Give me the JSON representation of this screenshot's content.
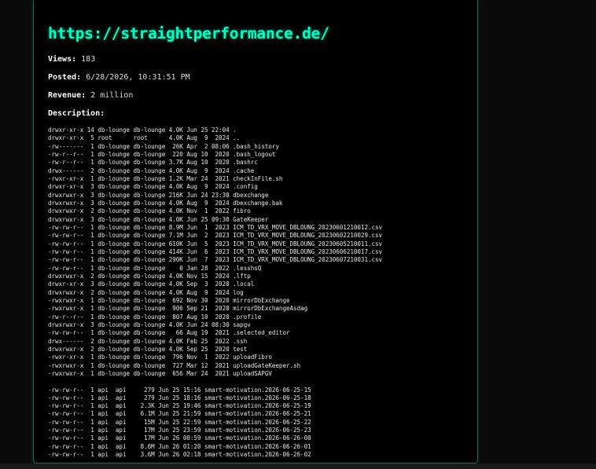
{
  "site": {
    "url": "https://straightperformance.de/"
  },
  "meta": {
    "views_label": "Views:",
    "views_value": "183",
    "posted_label": "Posted:",
    "posted_value": "6/28/2026, 10:31:51 PM",
    "revenue_label": "Revenue:",
    "revenue_value": "2 million",
    "description_label": "Description:"
  },
  "listing": {
    "block1": [
      "drwxr-xr-x 14 db-lounge db-lounge 4.0K Jun 25 22:04 .",
      "drwxr-xr-x  5 root      root      4.0K Aug  9  2024 ..",
      "-rw-------  1 db-lounge db-lounge  26K Apr  2 08:06 .bash_history",
      "-rw-r--r--  1 db-lounge db-lounge  220 Aug 10  2020 .bash_logout",
      "-rw-r--r--  1 db-lounge db-lounge 3.7K Aug 10  2020 .bashrc",
      "drwx------  2 db-lounge db-lounge 4.0K Aug  9  2024 .cache",
      "-rwxr-xr-x  1 db-lounge db-lounge 1.2K Mar 24  2021 checkInFile.sh",
      "drwxr-xr-x  3 db-lounge db-lounge 4.0K Aug  9  2024 .config",
      "drwxrwxr-x  3 db-lounge db-lounge 216K Jun 24 23:30 dbexchange",
      "drwxrwxr-x  3 db-lounge db-lounge 4.0K Aug  9  2024 dbexchange.bak",
      "drwxrwxr-x  2 db-lounge db-lounge 4.0K Nov  1  2022 fibro",
      "drwxrwxr-x  3 db-lounge db-lounge 4.0K Jun 25 09:30 GateKeeper",
      "-rw-rw-r--  1 db-lounge db-lounge 8.9M Jun  1  2023 ICM_TD_VRX_MOVE_DBLOUNG_20230601210012.csv",
      "-rw-rw-r--  1 db-lounge db-lounge 7.1M Jun  2  2023 ICM_TD_VRX_MOVE_DBLOUNG_20230602210029.csv",
      "-rw-rw-r--  1 db-lounge db-lounge 610K Jun  5  2023 ICM_TD_VRX_MOVE_DBLOUNG_20230605210011.csv",
      "-rw-rw-r--  1 db-lounge db-lounge 414K Jun  6  2023 ICM_TD_VRX_MOVE_DBLOUNG_20230606210017.csv",
      "-rw-rw-r--  1 db-lounge db-lounge 290K Jun  7  2023 ICM_TD_VRX_MOVE_DBLOUNG_20230607210031.csv",
      "-rw-rw-r--  1 db-lounge db-lounge    0 Jan 28  2022 .lesshsQ",
      "drwxrwxr-x  2 db-lounge db-lounge 4.0K Nov 15  2024 .lftp",
      "drwxr-xr-x  3 db-lounge db-lounge 4.0K Sep  3  2020 .local",
      "drwxrwxr-x  2 db-lounge db-lounge 4.0K Aug  9  2024 log",
      "-rwxrwxr-x  1 db-lounge db-lounge  692 Nov 30  2020 mirrorDbExchange",
      "-rwxrwxr-x  1 db-lounge db-lounge  906 Sep 21  2020 mirrorDbExchangeAsdag",
      "-rw-r--r--  1 db-lounge db-lounge  807 Aug 10  2020 .profile",
      "drwxrwxr-x  3 db-lounge db-lounge 4.0K Jun 24 08:30 sapgv",
      "-rw-rw-r--  1 db-lounge db-lounge   66 Aug 19  2021 .selected_editor",
      "drwx------  2 db-lounge db-lounge 4.0K Feb 25  2022 .ssh",
      "drwxrwxr-x  2 db-lounge db-lounge 4.0K Sep 25  2020 test",
      "-rwxr-xr-x  1 db-lounge db-lounge  796 Nov  1  2022 uploadFibro",
      "-rwxrwxr-x  1 db-lounge db-lounge  727 Mar 12  2021 uploadGateKeeper.sh",
      "-rwxrwxr-x  1 db-lounge db-lounge  656 Mar 24  2021 uploadSAPGV"
    ],
    "block2": [
      "-rw-rw-r--  1 api  api     279 Jun 25 15:16 smart-motivation.2026-06-25-15",
      "-rw-rw-r--  1 api  api     279 Jun 25 18:16 smart-motivation.2026-06-25-18",
      "-rw-rw-r--  1 api  api    2.3K Jun 25 19:46 smart-motivation.2026-06-25-19",
      "-rw-rw-r--  1 api  api    6.1M Jun 25 21:59 smart-motivation.2026-06-25-21",
      "-rw-rw-r--  1 api  api     15M Jun 25 22:59 smart-motivation.2026-06-25-22",
      "-rw-rw-r--  1 api  api     17M Jun 25 23:59 smart-motivation.2026-06-25-23",
      "-rw-rw-r--  1 api  api     17M Jun 26 00:59 smart-motivation.2026-06-26-00",
      "-rw-rw-r--  1 api  api    8.6M Jun 26 01:20 smart-motivation.2026-06-26-01",
      "-rw-rw-r--  1 api  api    3.6M Jun 26 02:18 smart-motivation.2026-06-26-02"
    ]
  }
}
